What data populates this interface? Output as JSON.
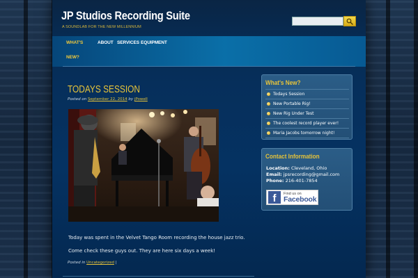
{
  "site": {
    "title": "JP Studios Recording Suite",
    "tagline": "A SOUNDLAB FOR THE NEW MILLENNIUM"
  },
  "search": {
    "placeholder": "",
    "value": ""
  },
  "nav": {
    "items": [
      {
        "label": "WHAT'S"
      },
      {
        "label": "NEW?"
      },
      {
        "label": "ABOUT"
      },
      {
        "label": "SERVICES"
      },
      {
        "label": "EQUIPMENT"
      }
    ]
  },
  "post": {
    "title": "TODAYS SESSION",
    "posted_on_label": "Posted on",
    "date": "September 22, 2014",
    "by_label": "by",
    "author": "jPowell",
    "photo_alt": "Jazz trio performing in the Velvet Tango Room",
    "paragraphs": [
      "Today was spent in the Velvet Tango Room recording the house jazz trio.",
      "Come check these guys out.  They are here six days a week!"
    ],
    "posted_in_label": "Posted in",
    "category": "Uncategorized",
    "separator": "|"
  },
  "sidebar": {
    "whats_new": {
      "title": "What's New?",
      "items": [
        {
          "label": "Todays Session"
        },
        {
          "label": "New Portable Rig!"
        },
        {
          "label": "New Rig Under Test"
        },
        {
          "label": "The coolest record player ever!"
        },
        {
          "label": "Maria Jacobs tomorrow night!"
        }
      ]
    },
    "contact": {
      "title": "Contact Information",
      "location_label": "Location:",
      "location": "Cleveland, Ohio",
      "email_label": "Email:",
      "email": "jpsrecording@gmail.com",
      "phone_label": "Phone:",
      "phone": "216-401-7854",
      "facebook_small": "Find us on",
      "facebook_big": "Facebook"
    }
  },
  "colors": {
    "accent_gold": "#e6c33a",
    "page_bg": "#053262",
    "nav_blue": "#0a6fa8",
    "facebook_blue": "#3b5998"
  }
}
